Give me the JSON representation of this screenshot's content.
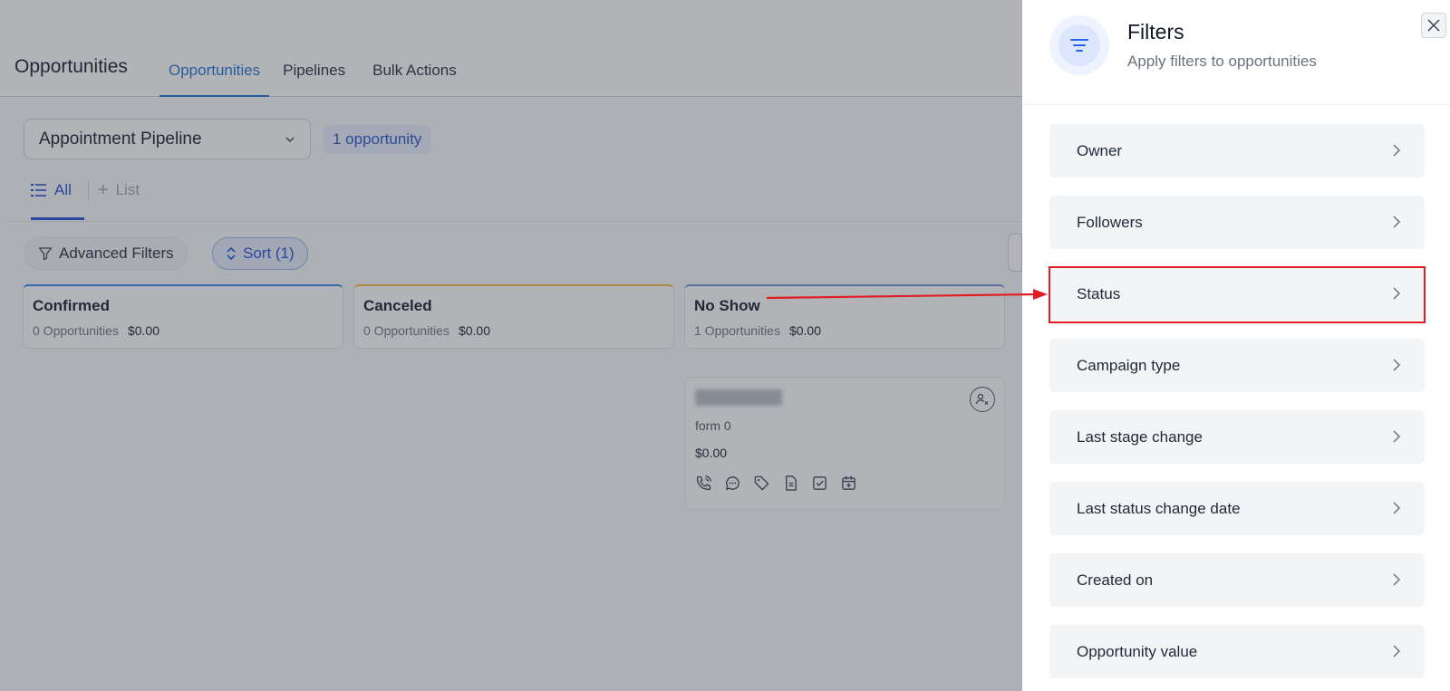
{
  "app": {
    "page_title": "Opportunities",
    "tabs": [
      {
        "label": "Opportunities",
        "active": true
      },
      {
        "label": "Pipelines",
        "active": false
      },
      {
        "label": "Bulk Actions",
        "active": false
      }
    ],
    "pipeline_select": {
      "value": "Appointment Pipeline"
    },
    "opportunity_count": "1 opportunity",
    "view_tabs": {
      "all_label": "All",
      "list_label": "List"
    },
    "buttons": {
      "advanced_filters": "Advanced Filters",
      "sort": "Sort (1)"
    },
    "columns": [
      {
        "name": "Confirmed",
        "count": "0 Opportunities",
        "value": "$0.00",
        "accent": "#2f80ed"
      },
      {
        "name": "Canceled",
        "count": "0 Opportunities",
        "value": "$0.00",
        "accent": "#f5b83a"
      },
      {
        "name": "No Show",
        "count": "1 Opportunities",
        "value": "$0.00",
        "accent": "#6b8fd6"
      }
    ],
    "card": {
      "source": "form 0",
      "value": "$0.00",
      "icons": [
        "phone-icon",
        "chat-icon",
        "tag-icon",
        "document-icon",
        "task-icon",
        "calendar-icon"
      ]
    }
  },
  "drawer": {
    "title": "Filters",
    "subtitle": "Apply filters to opportunities",
    "items": [
      {
        "label": "Owner"
      },
      {
        "label": "Followers"
      },
      {
        "label": "Status"
      },
      {
        "label": "Campaign type"
      },
      {
        "label": "Last stage change"
      },
      {
        "label": "Last status change date"
      },
      {
        "label": "Created on"
      },
      {
        "label": "Opportunity value"
      }
    ],
    "highlighted_item": "Status"
  },
  "colors": {
    "accent": "#1d4ed8",
    "annotation": "#e11d24"
  }
}
